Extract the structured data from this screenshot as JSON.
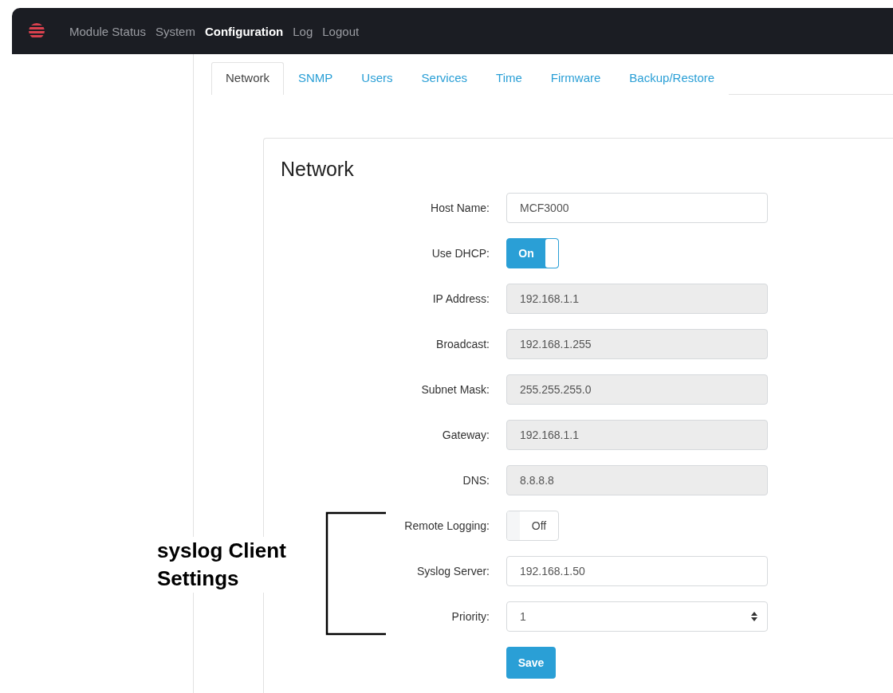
{
  "nav": {
    "items": [
      {
        "label": "Module Status",
        "selected": false
      },
      {
        "label": "System",
        "selected": false
      },
      {
        "label": "Configuration",
        "selected": true
      },
      {
        "label": "Log",
        "selected": false
      },
      {
        "label": "Logout",
        "selected": false
      }
    ]
  },
  "tabs": [
    {
      "label": "Network",
      "selected": true
    },
    {
      "label": "SNMP",
      "selected": false
    },
    {
      "label": "Users",
      "selected": false
    },
    {
      "label": "Services",
      "selected": false
    },
    {
      "label": "Time",
      "selected": false
    },
    {
      "label": "Firmware",
      "selected": false
    },
    {
      "label": "Backup/Restore",
      "selected": false
    }
  ],
  "form": {
    "title": "Network",
    "fields": [
      {
        "kind": "text",
        "label": "Host Name:",
        "value": "MCF3000"
      },
      {
        "kind": "toggle",
        "label": "Use DHCP:",
        "on": true,
        "state_label": "On"
      },
      {
        "kind": "readonly",
        "label": "IP Address:",
        "value": "192.168.1.1"
      },
      {
        "kind": "readonly",
        "label": "Broadcast:",
        "value": "192.168.1.255"
      },
      {
        "kind": "readonly",
        "label": "Subnet Mask:",
        "value": "255.255.255.0"
      },
      {
        "kind": "readonly",
        "label": "Gateway:",
        "value": "192.168.1.1"
      },
      {
        "kind": "readonly",
        "label": "DNS:",
        "value": "8.8.8.8"
      },
      {
        "kind": "toggle",
        "label": "Remote Logging:",
        "on": false,
        "state_label": "Off"
      },
      {
        "kind": "text",
        "label": "Syslog Server:",
        "value": "192.168.1.50"
      },
      {
        "kind": "select",
        "label": "Priority:",
        "value": "1"
      }
    ],
    "save_button": "Save"
  },
  "annotation": {
    "text": "syslog Client Settings"
  }
}
